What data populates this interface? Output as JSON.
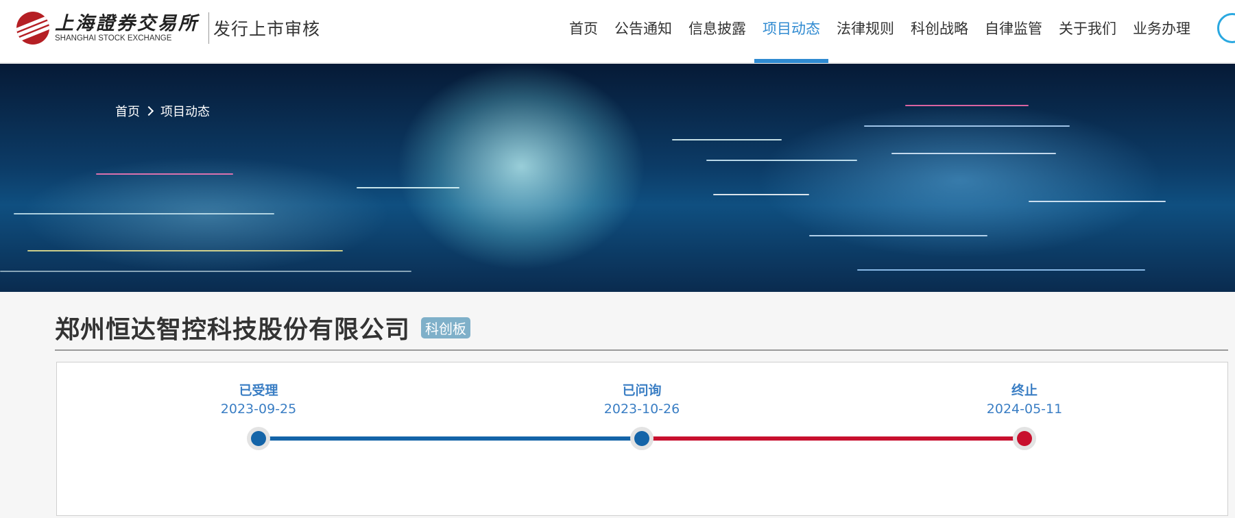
{
  "header": {
    "logo_cn": "上海證券交易所",
    "logo_en": "SHANGHAI STOCK EXCHANGE",
    "section_title": "发行上市审核",
    "nav": [
      {
        "label": "首页",
        "active": false
      },
      {
        "label": "公告通知",
        "active": false
      },
      {
        "label": "信息披露",
        "active": false
      },
      {
        "label": "项目动态",
        "active": true
      },
      {
        "label": "法律规则",
        "active": false
      },
      {
        "label": "科创战略",
        "active": false
      },
      {
        "label": "自律监管",
        "active": false
      },
      {
        "label": "关于我们",
        "active": false
      },
      {
        "label": "业务办理",
        "active": false
      }
    ],
    "search_icon": "search-icon",
    "accent_color": "#2f8ad1"
  },
  "breadcrumb": {
    "home": "首页",
    "current": "项目动态"
  },
  "company": {
    "name": "郑州恒达智控科技股份有限公司",
    "board": "科创板"
  },
  "timeline": {
    "steps": [
      {
        "label": "已受理",
        "date": "2023-09-25",
        "color": "#1464a8"
      },
      {
        "label": "已问询",
        "date": "2023-10-26",
        "color": "#1464a8"
      },
      {
        "label": "终止",
        "date": "2024-05-11",
        "color": "#c8102e"
      }
    ],
    "colors": {
      "progress": "#1464a8",
      "terminated": "#c8102e",
      "text": "#3a7ec4"
    }
  }
}
